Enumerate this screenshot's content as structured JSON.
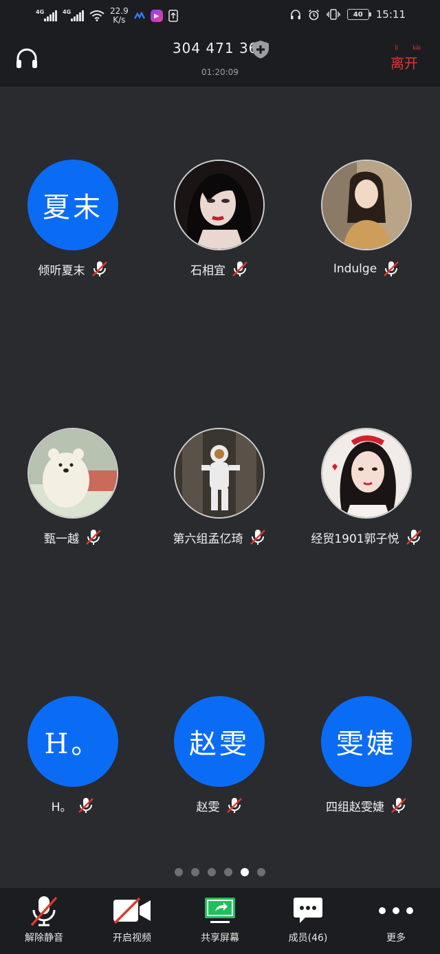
{
  "status_bar": {
    "signal1": "4G",
    "signal2": "4G",
    "speed_value": "22.9",
    "speed_unit": "K/s",
    "battery": "40",
    "time": "15:11"
  },
  "header": {
    "meeting_id": "304 471 367",
    "duration": "01:20:09",
    "leave_label": "离开",
    "leave_pinyin_1": "lí",
    "leave_pinyin_2": "kāi"
  },
  "participants": [
    {
      "name": "倾听夏末",
      "avatar_text": "夏末",
      "avatar_color": "#0a6cf5"
    },
    {
      "name": "石相宜",
      "avatar_text": ""
    },
    {
      "name": "Indulge",
      "avatar_text": ""
    },
    {
      "name": "甄一越",
      "avatar_text": ""
    },
    {
      "name": "第六组孟亿琦",
      "avatar_text": ""
    },
    {
      "name": "经贸1901郭子悦",
      "avatar_text": ""
    },
    {
      "name": "H。",
      "avatar_text": "H。",
      "avatar_color": "#0a6cf5"
    },
    {
      "name": "赵雯",
      "avatar_text": "赵雯",
      "avatar_color": "#0a6cf5"
    },
    {
      "name": "四组赵雯婕",
      "avatar_text": "雯婕",
      "avatar_color": "#0a6cf5"
    }
  ],
  "pagination": {
    "pages": 6,
    "current": 5
  },
  "toolbar": {
    "unmute": "解除静音",
    "video": "开启视频",
    "share": "共享屏幕",
    "members": "成员(46)",
    "more": "更多"
  },
  "colors": {
    "avatar_blue": "#0a6cf5",
    "muted_red": "#e0382f",
    "share_green": "#1fbf5a",
    "background": "#292b2f",
    "bar": "#1c1d20"
  },
  "icons": {
    "audio": "headphone-icon",
    "security": "shield-plus-icon",
    "mic_off": "mic-off-icon",
    "video_off": "video-off-icon",
    "share": "share-screen-icon",
    "members": "chat-icon",
    "more": "more-dots-icon"
  }
}
